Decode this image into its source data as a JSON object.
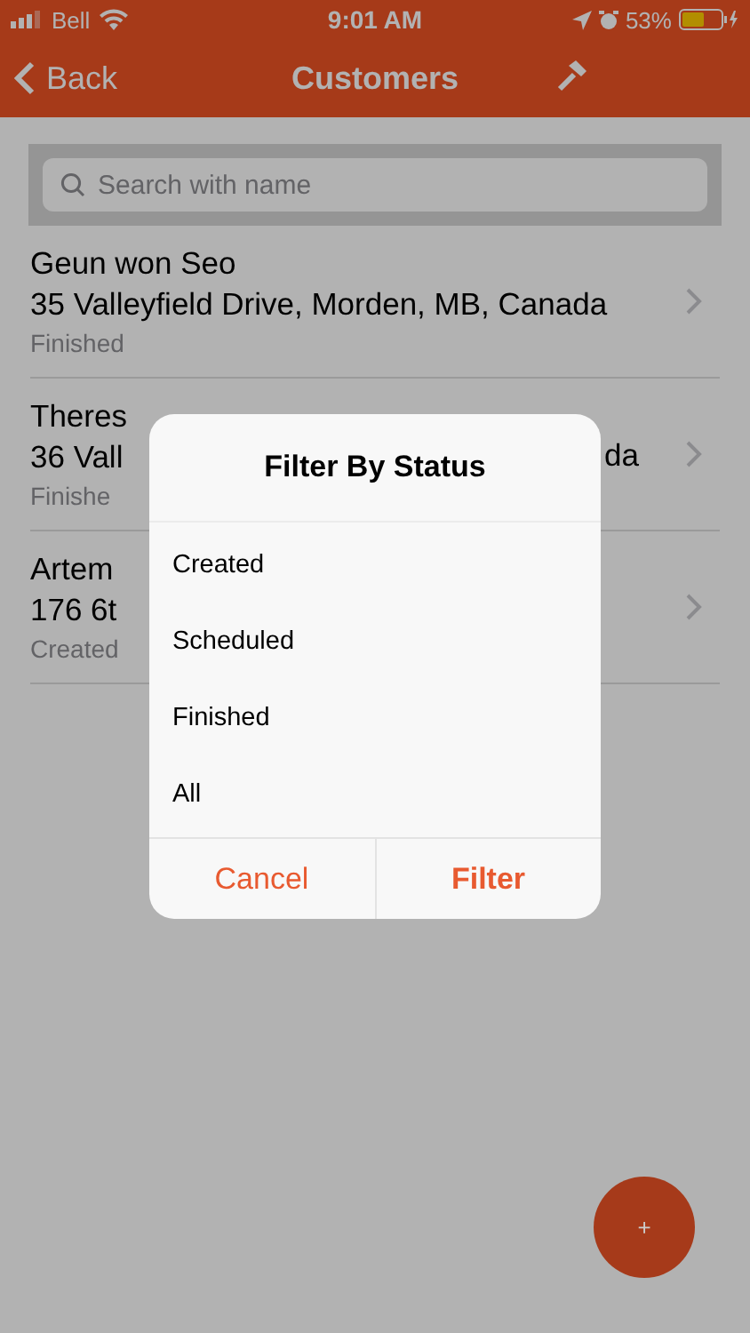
{
  "status_bar": {
    "carrier": "Bell",
    "time": "9:01 AM",
    "battery": "53%"
  },
  "nav": {
    "back": "Back",
    "title": "Customers"
  },
  "search": {
    "placeholder": "Search with name"
  },
  "customers": [
    {
      "name": "Geun won Seo",
      "address": "35 Valleyfield Drive, Morden, MB, Canada",
      "status": "Finished"
    },
    {
      "name": "Theres",
      "address": "36 Vall",
      "address_tail": "da",
      "status": "Finishe"
    },
    {
      "name": "Artem",
      "address": "176 6t",
      "status": "Created"
    }
  ],
  "dialog": {
    "title": "Filter By Status",
    "options": [
      "Created",
      "Scheduled",
      "Finished",
      "All"
    ],
    "cancel": "Cancel",
    "confirm": "Filter"
  },
  "fab": {
    "label": "+"
  }
}
